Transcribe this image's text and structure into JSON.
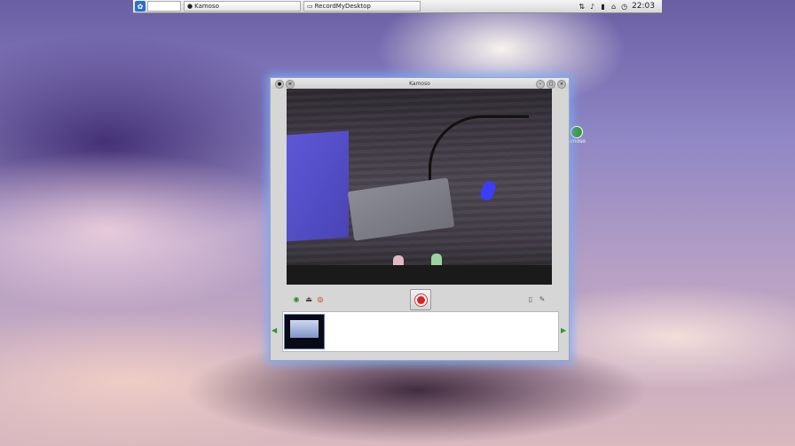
{
  "taskbar": {
    "task1_label": "Kamoso",
    "task2_label": "RecordMyDesktop",
    "clock": "22:03",
    "icons": [
      "kde-launcher-icon",
      "network-icon",
      "volume-icon",
      "battery-icon",
      "home-icon",
      "clock-icon"
    ]
  },
  "desktop": {
    "icon_label": "amoso"
  },
  "window": {
    "title": "Kamoso",
    "title_icons": [
      "app-icon",
      "menu-icon",
      "shade-button",
      "maximize-button",
      "close-button"
    ]
  },
  "toolbar": {
    "left_icons": [
      "webcam-icon",
      "eject-icon",
      "record-mode-icon"
    ],
    "center": "record-button",
    "right_icons": [
      "page-icon",
      "settings-icon"
    ]
  },
  "filmstrip": {
    "items": 1
  },
  "colors": {
    "window_glow": "#78aaff",
    "record": "#d22222",
    "arrow": "#2a9a2a"
  }
}
